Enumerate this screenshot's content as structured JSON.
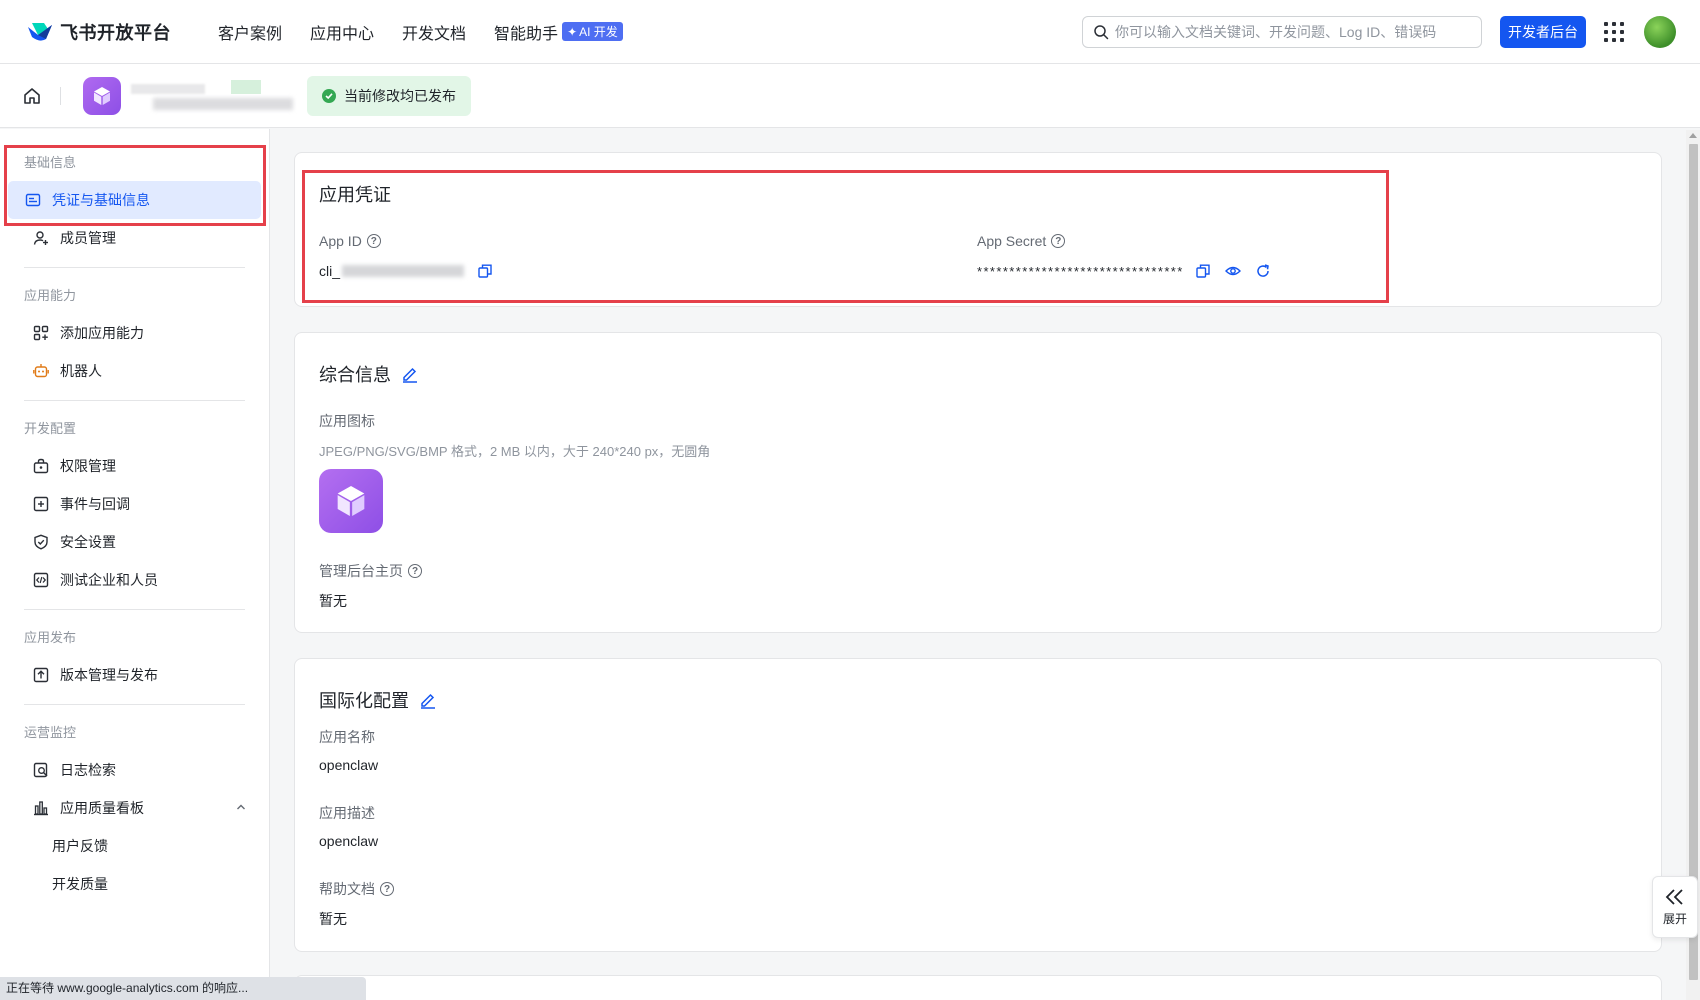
{
  "topnav": {
    "logo_text": "飞书开放平台",
    "items": [
      {
        "label": "客户案例"
      },
      {
        "label": "应用中心"
      },
      {
        "label": "开发文档"
      },
      {
        "label": "智能助手",
        "badge": "AI 开发"
      }
    ],
    "search_placeholder": "你可以输入文档关键词、开发问题、Log ID、错误码",
    "dev_button": "开发者后台"
  },
  "subheader": {
    "status_text": "当前修改均已发布"
  },
  "sidebar": {
    "groups": [
      {
        "title": "基础信息",
        "items": [
          {
            "label": "凭证与基础信息",
            "icon": "credential-icon",
            "active": true
          },
          {
            "label": "成员管理",
            "icon": "member-icon"
          }
        ]
      },
      {
        "title": "应用能力",
        "items": [
          {
            "label": "添加应用能力",
            "icon": "add-capability-icon"
          },
          {
            "label": "机器人",
            "icon": "robot-icon"
          }
        ]
      },
      {
        "title": "开发配置",
        "items": [
          {
            "label": "权限管理",
            "icon": "permission-icon"
          },
          {
            "label": "事件与回调",
            "icon": "event-icon"
          },
          {
            "label": "安全设置",
            "icon": "shield-icon"
          },
          {
            "label": "测试企业和人员",
            "icon": "code-icon"
          }
        ]
      },
      {
        "title": "应用发布",
        "items": [
          {
            "label": "版本管理与发布",
            "icon": "upload-icon"
          }
        ]
      },
      {
        "title": "运营监控",
        "items": [
          {
            "label": "日志检索",
            "icon": "log-search-icon"
          },
          {
            "label": "应用质量看板",
            "icon": "bar-chart-icon"
          },
          {
            "label": "用户反馈"
          },
          {
            "label": "开发质量"
          }
        ]
      }
    ]
  },
  "credentials": {
    "title": "应用凭证",
    "app_id_label": "App ID",
    "app_id_value": "cli_",
    "app_secret_label": "App Secret",
    "app_secret_value": "********************************"
  },
  "general": {
    "title": "综合信息",
    "icon_label": "应用图标",
    "icon_hint": "JPEG/PNG/SVG/BMP 格式，2 MB 以内，大于 240*240 px，无圆角",
    "admin_home_label": "管理后台主页",
    "admin_home_value": "暂无"
  },
  "i18n": {
    "title": "国际化配置",
    "name_label": "应用名称",
    "name_value": "openclaw",
    "desc_label": "应用描述",
    "desc_value": "openclaw",
    "help_label": "帮助文档",
    "help_value": "暂无"
  },
  "expand_label": "展开",
  "browser_status": "正在等待 www.google-analytics.com 的响应..."
}
